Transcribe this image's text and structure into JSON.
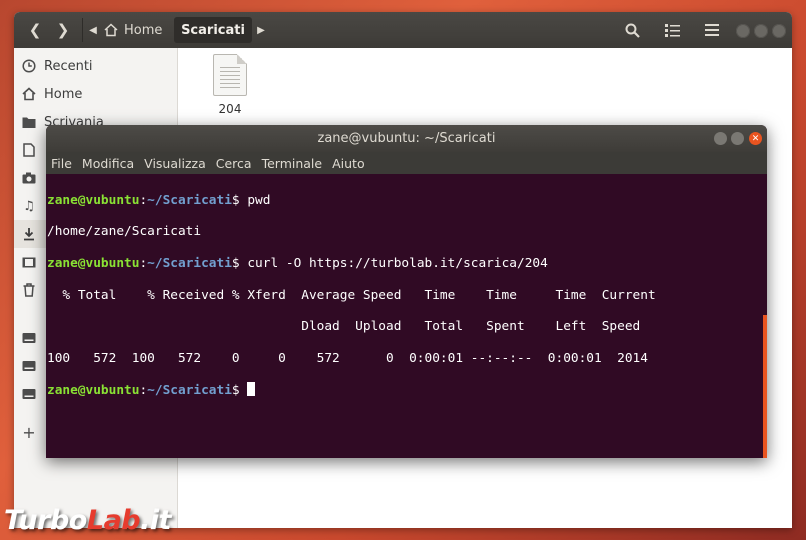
{
  "files_window": {
    "path_home": "Home",
    "path_current": "Scaricati",
    "sidebar": [
      {
        "label": "Recenti",
        "icon": "clock-icon"
      },
      {
        "label": "Home",
        "icon": "home-icon"
      },
      {
        "label": "Scrivania",
        "icon": "folder-icon"
      }
    ],
    "files": [
      {
        "name": "204"
      }
    ]
  },
  "terminal": {
    "title": "zane@vubuntu: ~/Scaricati",
    "menu": [
      "File",
      "Modifica",
      "Visualizza",
      "Cerca",
      "Terminale",
      "Aiuto"
    ],
    "prompt_user": "zane@vubuntu",
    "prompt_path": "~/Scaricati",
    "cmd1": " pwd",
    "out1": "/home/zane/Scaricati",
    "cmd2": " curl -O https://turbolab.it/scarica/204",
    "out2": "  % Total    % Received % Xferd  Average Speed   Time    Time     Time  Current",
    "out3": "                                 Dload  Upload   Total   Spent    Left  Speed",
    "out4": "100   572  100   572    0     0    572      0  0:00:01 --:--:--  0:00:01  2014"
  },
  "watermark": {
    "part1": "Turbo",
    "part2": "Lab",
    "part3": ".it"
  },
  "colors": {
    "terminal_bg": "#300a24",
    "prompt_user": "#8ae234",
    "prompt_path": "#729fcf",
    "accent": "#e95420"
  }
}
